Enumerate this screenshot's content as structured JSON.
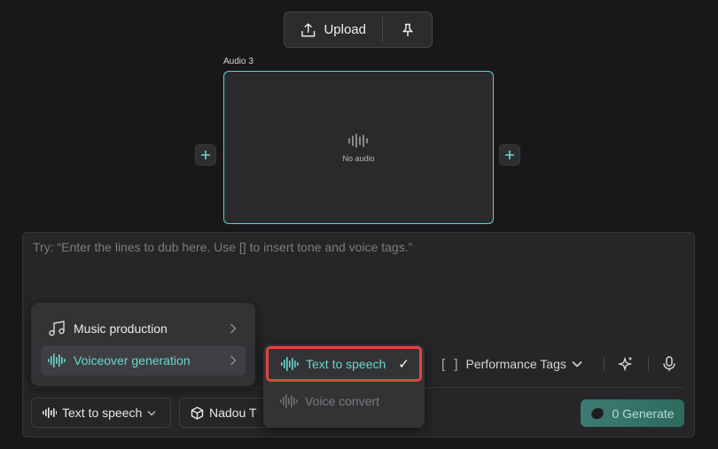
{
  "toolbar": {
    "upload_label": "Upload"
  },
  "audio": {
    "label": "Audio 3",
    "empty_text": "No audio"
  },
  "prompt": {
    "placeholder": "Try: “Enter the lines to dub here. Use [] to insert tone and voice tags.”"
  },
  "controls": {
    "performance_tags_label": "Performance Tags",
    "mode_label": "Text to speech",
    "model_label": "Nadou T",
    "generate_count": "0",
    "generate_label": "Generate"
  },
  "menu": {
    "items": [
      {
        "label": "Music production",
        "icon": "music-note-icon"
      },
      {
        "label": "Voiceover generation",
        "icon": "waveform-icon",
        "active": true
      }
    ],
    "submenu": [
      {
        "label": "Text to speech",
        "selected": true,
        "check": "✓"
      },
      {
        "label": "Voice convert",
        "disabled": true
      }
    ]
  },
  "colors": {
    "accent": "#5ad6cf",
    "highlight_border": "#e0463e",
    "background": "#18181a"
  }
}
